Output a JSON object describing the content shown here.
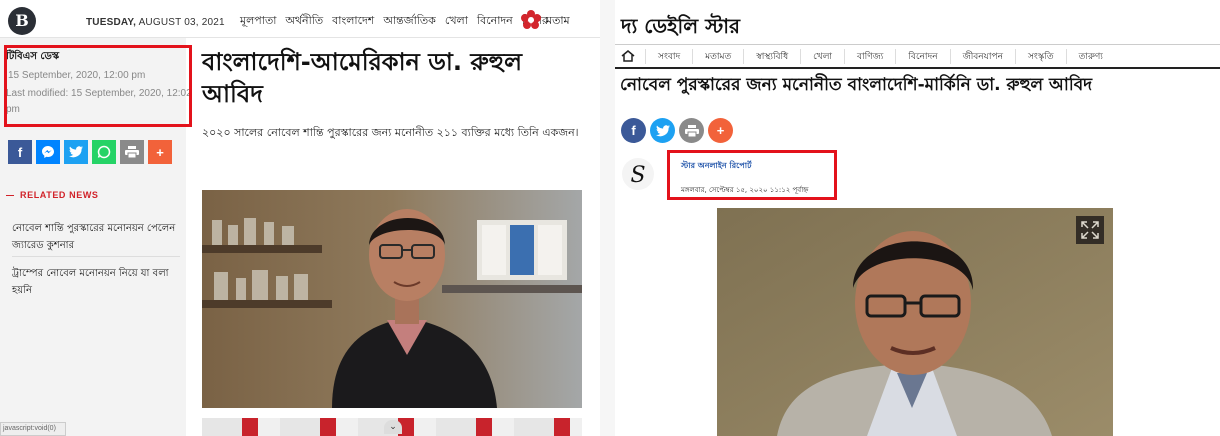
{
  "left": {
    "logo_letter": "B",
    "date_day": "TUESDAY,",
    "date_rest": " AUGUST 03, 2021",
    "nav": [
      "মূলপাতা",
      "অর্থনীতি",
      "বাংলাদেশ",
      "আন্তর্জাতিক",
      "খেলা",
      "বিনোদন",
      "ফিচার"
    ],
    "nav_end": "মতাম",
    "desk": "টিবিএস ডেস্ক",
    "published": "15 September, 2020, 12:00 pm",
    "modified": "Last modified: 15 September, 2020, 12:02 pm",
    "share_icons": [
      "facebook-icon",
      "messenger-icon",
      "twitter-icon",
      "whatsapp-icon",
      "print-icon",
      "plus-icon"
    ],
    "related_label": "RELATED NEWS",
    "related": [
      "নোবেল শান্তি পুরস্কারের মনোনয়ন পেলেন জ্যারেড কুশনার",
      "ট্রাম্পের নোবেল মনোনয়ন নিয়ে যা বলা হয়নি"
    ],
    "headline": "বাংলাদেশি-আমেরিকান ডা. রুহুল আবিদ",
    "subhead": "২০২০ সালের নোবেল শান্তি পুরস্কারের জন্য মনোনীত ২১১ ব্যক্তির মধ্যে তিনি একজন।",
    "status_text": "javascript:void(0)",
    "chevron": "⌄"
  },
  "right": {
    "masthead": "দ্য ডেইলি স্টার",
    "nav": [
      "সংবাদ",
      "মতামত",
      "স্বাস্থ্যবিধি",
      "খেলা",
      "বাণিজ্য",
      "বিনোদন",
      "জীবনযাপন",
      "সংস্কৃতি",
      "তারুণ্য"
    ],
    "headline": "নোবেল পুরস্কারের জন্য মনোনীত বাংলাদেশি-মার্কিনি ডা. রুহুল আবিদ",
    "share_icons": [
      "facebook-icon",
      "twitter-icon",
      "print-icon",
      "plus-icon"
    ],
    "author": "স্টার অনলাইন রিপোর্ট",
    "date": "মঙ্গলবার, সেপ্টেম্বর ১৫, ২০২০ ১১:১২ পূর্বাহ্ন"
  },
  "colors": {
    "highlight_red": "#e3121b",
    "facebook": "#3b5998",
    "messenger": "#0084ff",
    "twitter": "#1da1f2",
    "whatsapp": "#25d366",
    "print": "#8a8a8a",
    "plus": "#f2623a"
  }
}
